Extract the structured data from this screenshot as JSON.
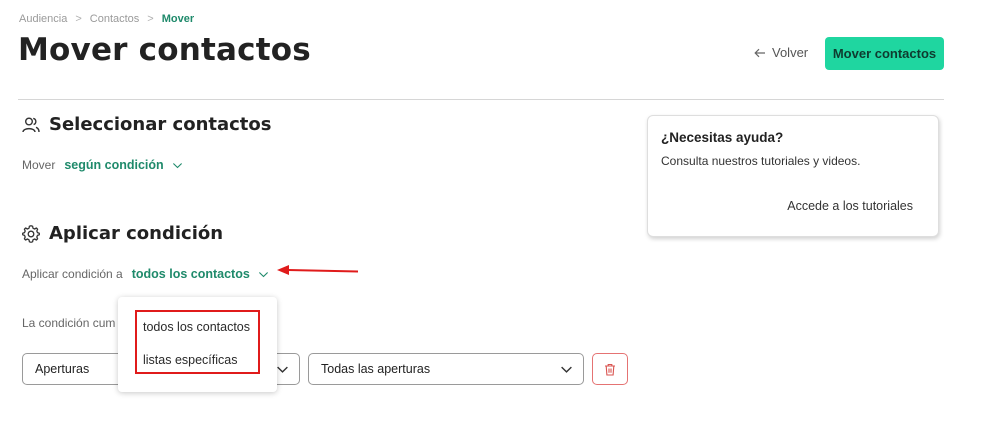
{
  "breadcrumb": {
    "items": [
      "Audiencia",
      "Contactos",
      "Mover"
    ],
    "separator": ">"
  },
  "header": {
    "title": "Mover contactos",
    "back_label": "Volver",
    "back_icon": "arrow-left-icon",
    "primary_label": "Mover contactos"
  },
  "select_contacts": {
    "title": "Seleccionar contactos",
    "icon": "users-icon",
    "move_label": "Mover",
    "move_value": "según condición"
  },
  "apply_condition": {
    "title": "Aplicar condición",
    "icon": "gear-icon",
    "apply_label": "Aplicar condición a",
    "apply_value": "todos los contactos",
    "condition_label": "La condición cum"
  },
  "dropdown_menu": {
    "options": [
      "todos los contactos",
      "listas específicas"
    ]
  },
  "filters": {
    "field_value": "Aperturas",
    "operator_value": "Todas las aperturas"
  },
  "help": {
    "title": "¿Necesitas ayuda?",
    "text": "Consulta nuestros tutoriales y videos.",
    "link": "Accede a los tutoriales"
  },
  "colors": {
    "accent": "#1f8a6b",
    "primary_button": "#1fd6a0",
    "annotation_red": "#e01b1b",
    "danger": "#e57373"
  }
}
